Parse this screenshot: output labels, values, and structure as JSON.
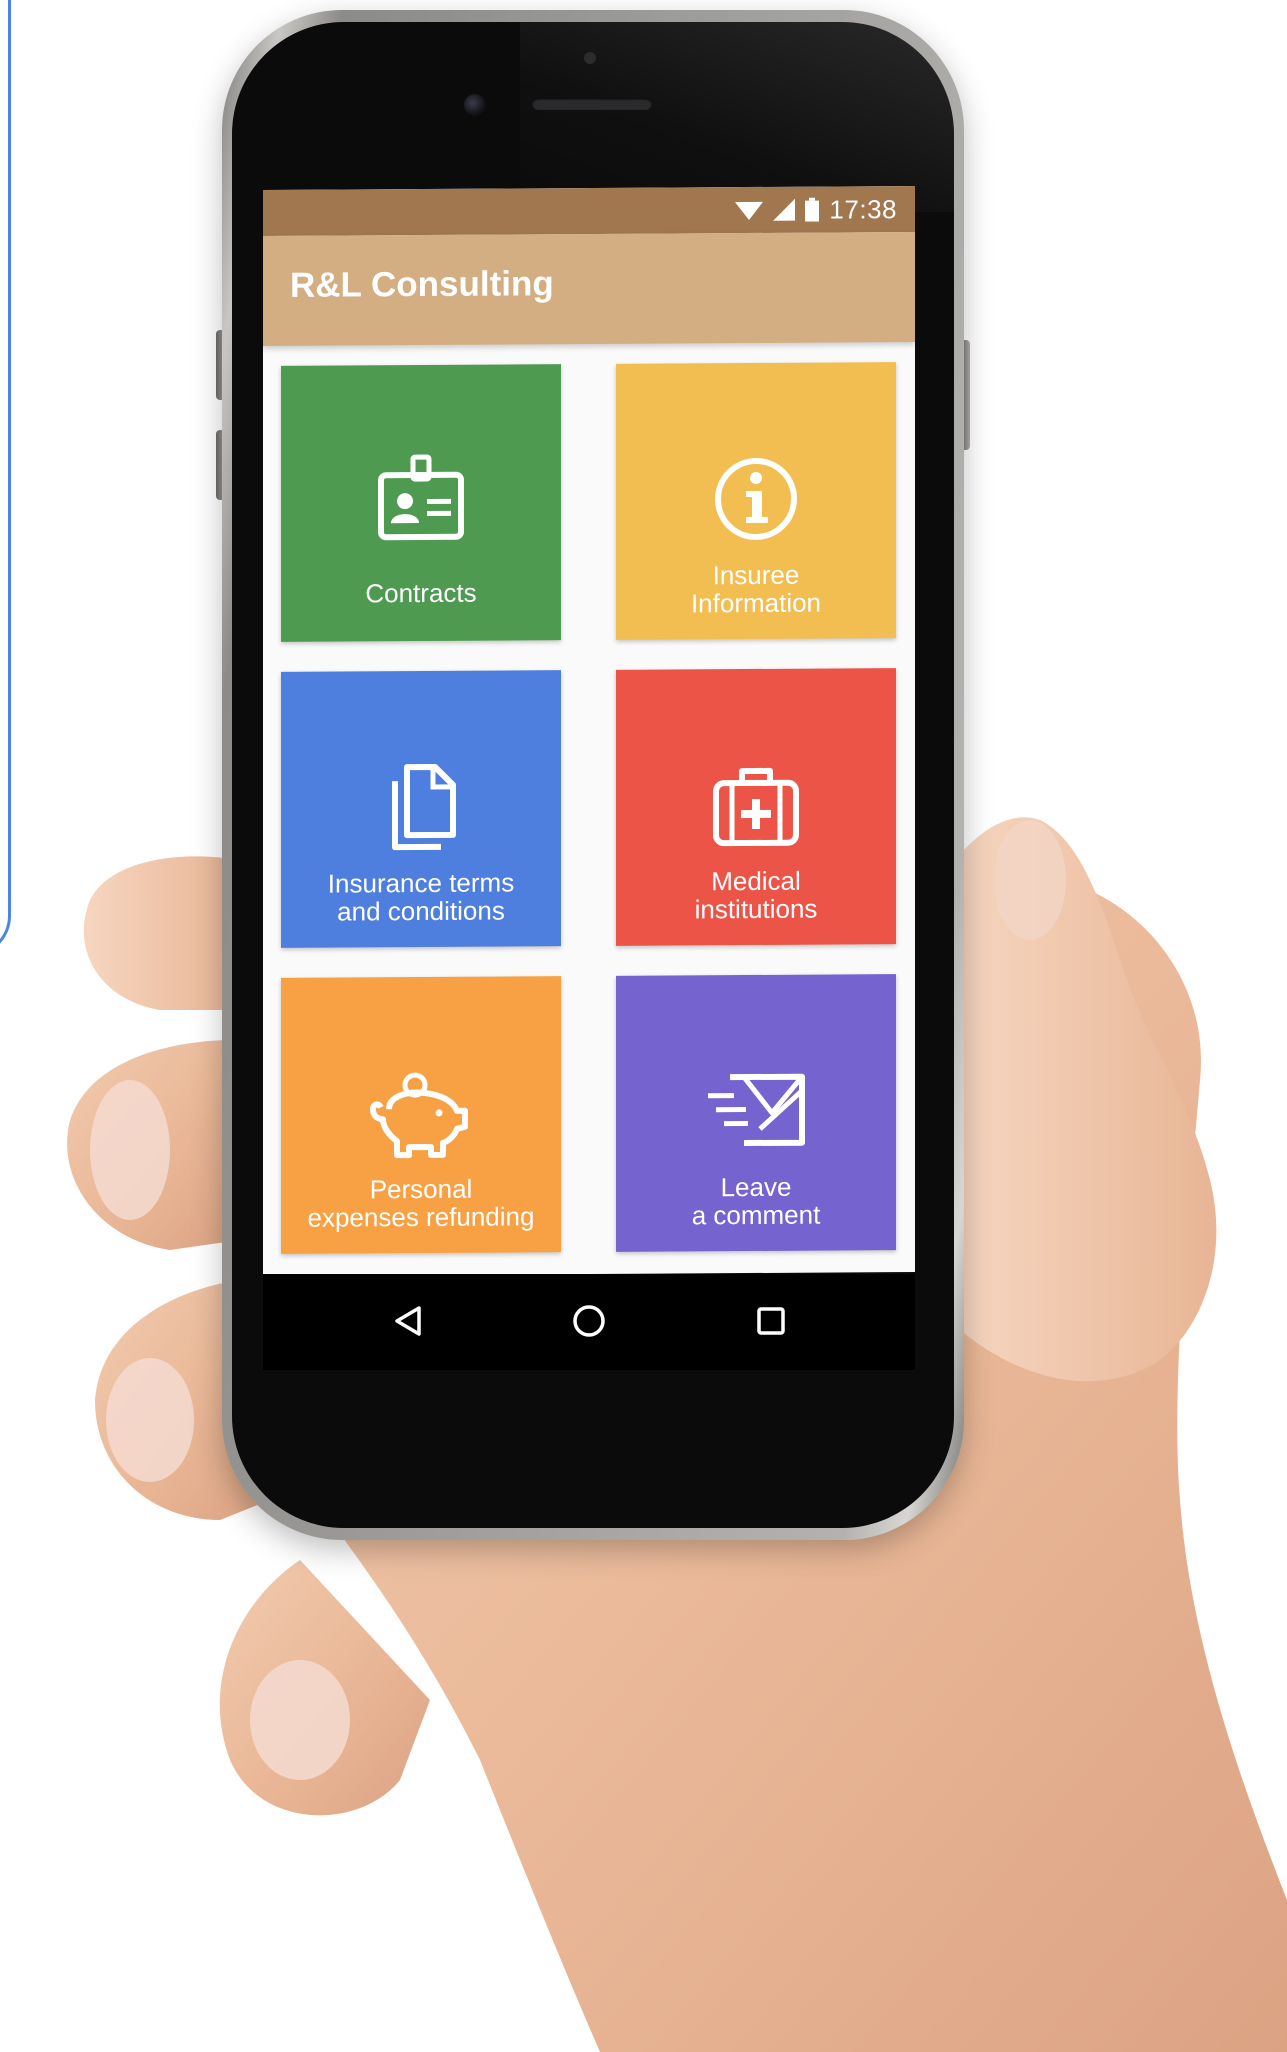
{
  "status_bar": {
    "time": "17:38",
    "icons": [
      "wifi-icon",
      "signal-icon",
      "battery-icon"
    ]
  },
  "app": {
    "title": "R&L Consulting",
    "accent_dark": "#a0774f",
    "accent": "#d4ae83"
  },
  "tiles": [
    {
      "label_line1": "Contracts",
      "label_line2": "",
      "icon": "id-badge-icon",
      "color": "#4e9a51"
    },
    {
      "label_line1": "Insuree",
      "label_line2": "Information",
      "icon": "info-icon",
      "color": "#f2be52"
    },
    {
      "label_line1": "Insurance terms",
      "label_line2": "and conditions",
      "icon": "documents-icon",
      "color": "#4f7fde"
    },
    {
      "label_line1": "Medical",
      "label_line2": "institutions",
      "icon": "first-aid-kit-icon",
      "color": "#eb5446"
    },
    {
      "label_line1": "Personal",
      "label_line2": "expenses refunding",
      "icon": "piggy-bank-icon",
      "color": "#f8a144"
    },
    {
      "label_line1": "Leave",
      "label_line2": "a comment",
      "icon": "send-message-icon",
      "color": "#7563cf"
    }
  ],
  "nav_bar": {
    "buttons": [
      "back-icon",
      "home-icon",
      "recents-icon"
    ]
  }
}
